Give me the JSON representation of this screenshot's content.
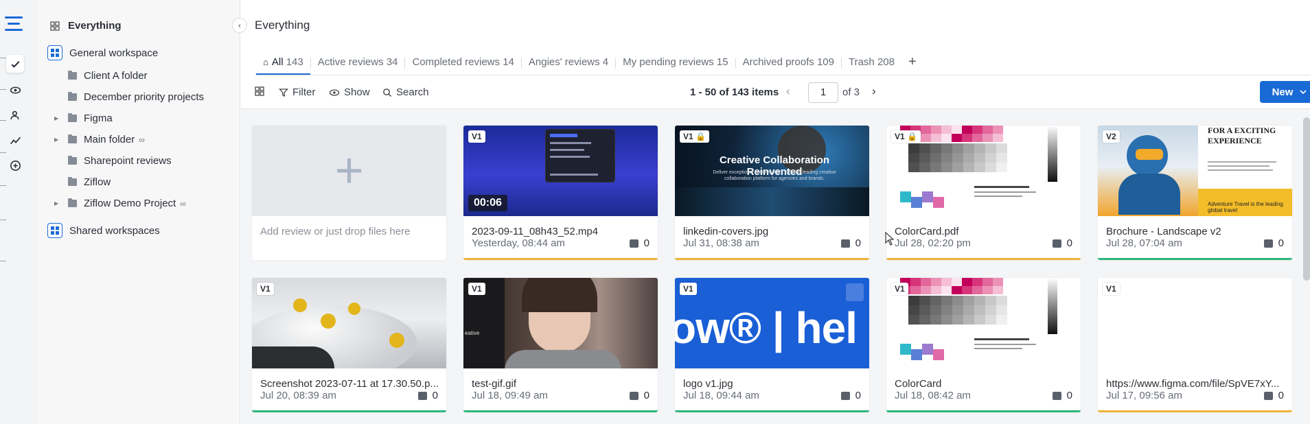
{
  "colors": {
    "accent": "#1a6ad6",
    "status_approved": "#2eb67d",
    "status_pending": "#f0b23a"
  },
  "rail": {
    "logo_icon": "ziflow-logo-icon",
    "items": [
      {
        "name": "reviews-icon"
      },
      {
        "name": "eye-icon"
      },
      {
        "name": "people-icon"
      },
      {
        "name": "analytics-icon"
      },
      {
        "name": "add-circle-icon"
      }
    ]
  },
  "sidebar": {
    "everything_label": "Everything",
    "workspace_label": "General workspace",
    "folders": [
      {
        "label": "Client A folder",
        "expandable": false,
        "linked": false
      },
      {
        "label": "December priority projects",
        "expandable": false,
        "linked": false
      },
      {
        "label": "Figma",
        "expandable": true,
        "linked": false
      },
      {
        "label": "Main folder",
        "expandable": true,
        "linked": true
      },
      {
        "label": "Sharepoint reviews",
        "expandable": false,
        "linked": false
      },
      {
        "label": "Ziflow",
        "expandable": false,
        "linked": false
      },
      {
        "label": "Ziflow Demo Project",
        "expandable": true,
        "linked": true
      }
    ],
    "shared_label": "Shared workspaces"
  },
  "header": {
    "title": "Everything"
  },
  "tabs": [
    {
      "label": "All",
      "count": "143",
      "active": true
    },
    {
      "label": "Active reviews",
      "count": "34"
    },
    {
      "label": "Completed reviews",
      "count": "14"
    },
    {
      "label": "Angies' reviews",
      "count": "4"
    },
    {
      "label": "My pending reviews",
      "count": "15"
    },
    {
      "label": "Archived proofs",
      "count": "109"
    },
    {
      "label": "Trash",
      "count": "208"
    }
  ],
  "toolbar": {
    "filter_label": "Filter",
    "show_label": "Show",
    "search_label": "Search",
    "pager_text": "1 - 50 of 143 items",
    "page_value": "1",
    "page_of": "of 3",
    "new_label": "New"
  },
  "add_card": {
    "text": "Add review or just drop files here"
  },
  "cards": [
    {
      "version": "V1",
      "name": "2023-09-11_08h43_52.mp4",
      "date": "Yesterday, 08:44 am",
      "comments": "0",
      "status": "pending",
      "thumb": "video-dark",
      "duration": "00:06"
    },
    {
      "version": "V1",
      "locked": true,
      "name": "linkedin-covers.jpg",
      "date": "Jul 31, 08:38 am",
      "comments": "0",
      "status": "pending",
      "thumb": "collab",
      "thumb_title": "Creative Collaboration Reinvented",
      "thumb_sub": "Deliver exceptional creative work with the leading creative collaboration platform for agencies and brands."
    },
    {
      "version": "V1",
      "locked": true,
      "name": "ColorCard.pdf",
      "date": "Jul 28, 02:20 pm",
      "comments": "0",
      "status": "pending",
      "thumb": "colorcard"
    },
    {
      "version": "V2",
      "name": "Brochure - Landscape v2",
      "date": "Jul 28, 07:04 am",
      "comments": "0",
      "status": "approved",
      "thumb": "brochure",
      "thumb_title": "FOR A EXCITING EXPERIENCE",
      "thumb_sub": "Adventure Travel is the leading global travel"
    },
    {
      "version": "V1",
      "name": "Screenshot 2023-07-11 at 17.30.50.p...",
      "date": "Jul 20, 08:39 am",
      "comments": "0",
      "status": "approved",
      "thumb": "car"
    },
    {
      "version": "V1",
      "name": "test-gif.gif",
      "date": "Jul 18, 09:49 am",
      "comments": "0",
      "status": "approved",
      "thumb": "portrait",
      "thumb_side": "eative"
    },
    {
      "version": "V1",
      "name": "logo v1.jpg",
      "date": "Jul 18, 09:44 am",
      "comments": "0",
      "status": "approved",
      "thumb": "logo",
      "thumb_text": "ow® | hel"
    },
    {
      "version": "V1",
      "name": "ColorCard",
      "date": "Jul 18, 08:42 am",
      "comments": "0",
      "status": "approved",
      "thumb": "colorcard"
    },
    {
      "version": "V1",
      "name": "https://www.figma.com/file/SpVE7xY...",
      "date": "Jul 17, 09:56 am",
      "comments": "0",
      "status": "pending",
      "thumb": "blank"
    }
  ]
}
